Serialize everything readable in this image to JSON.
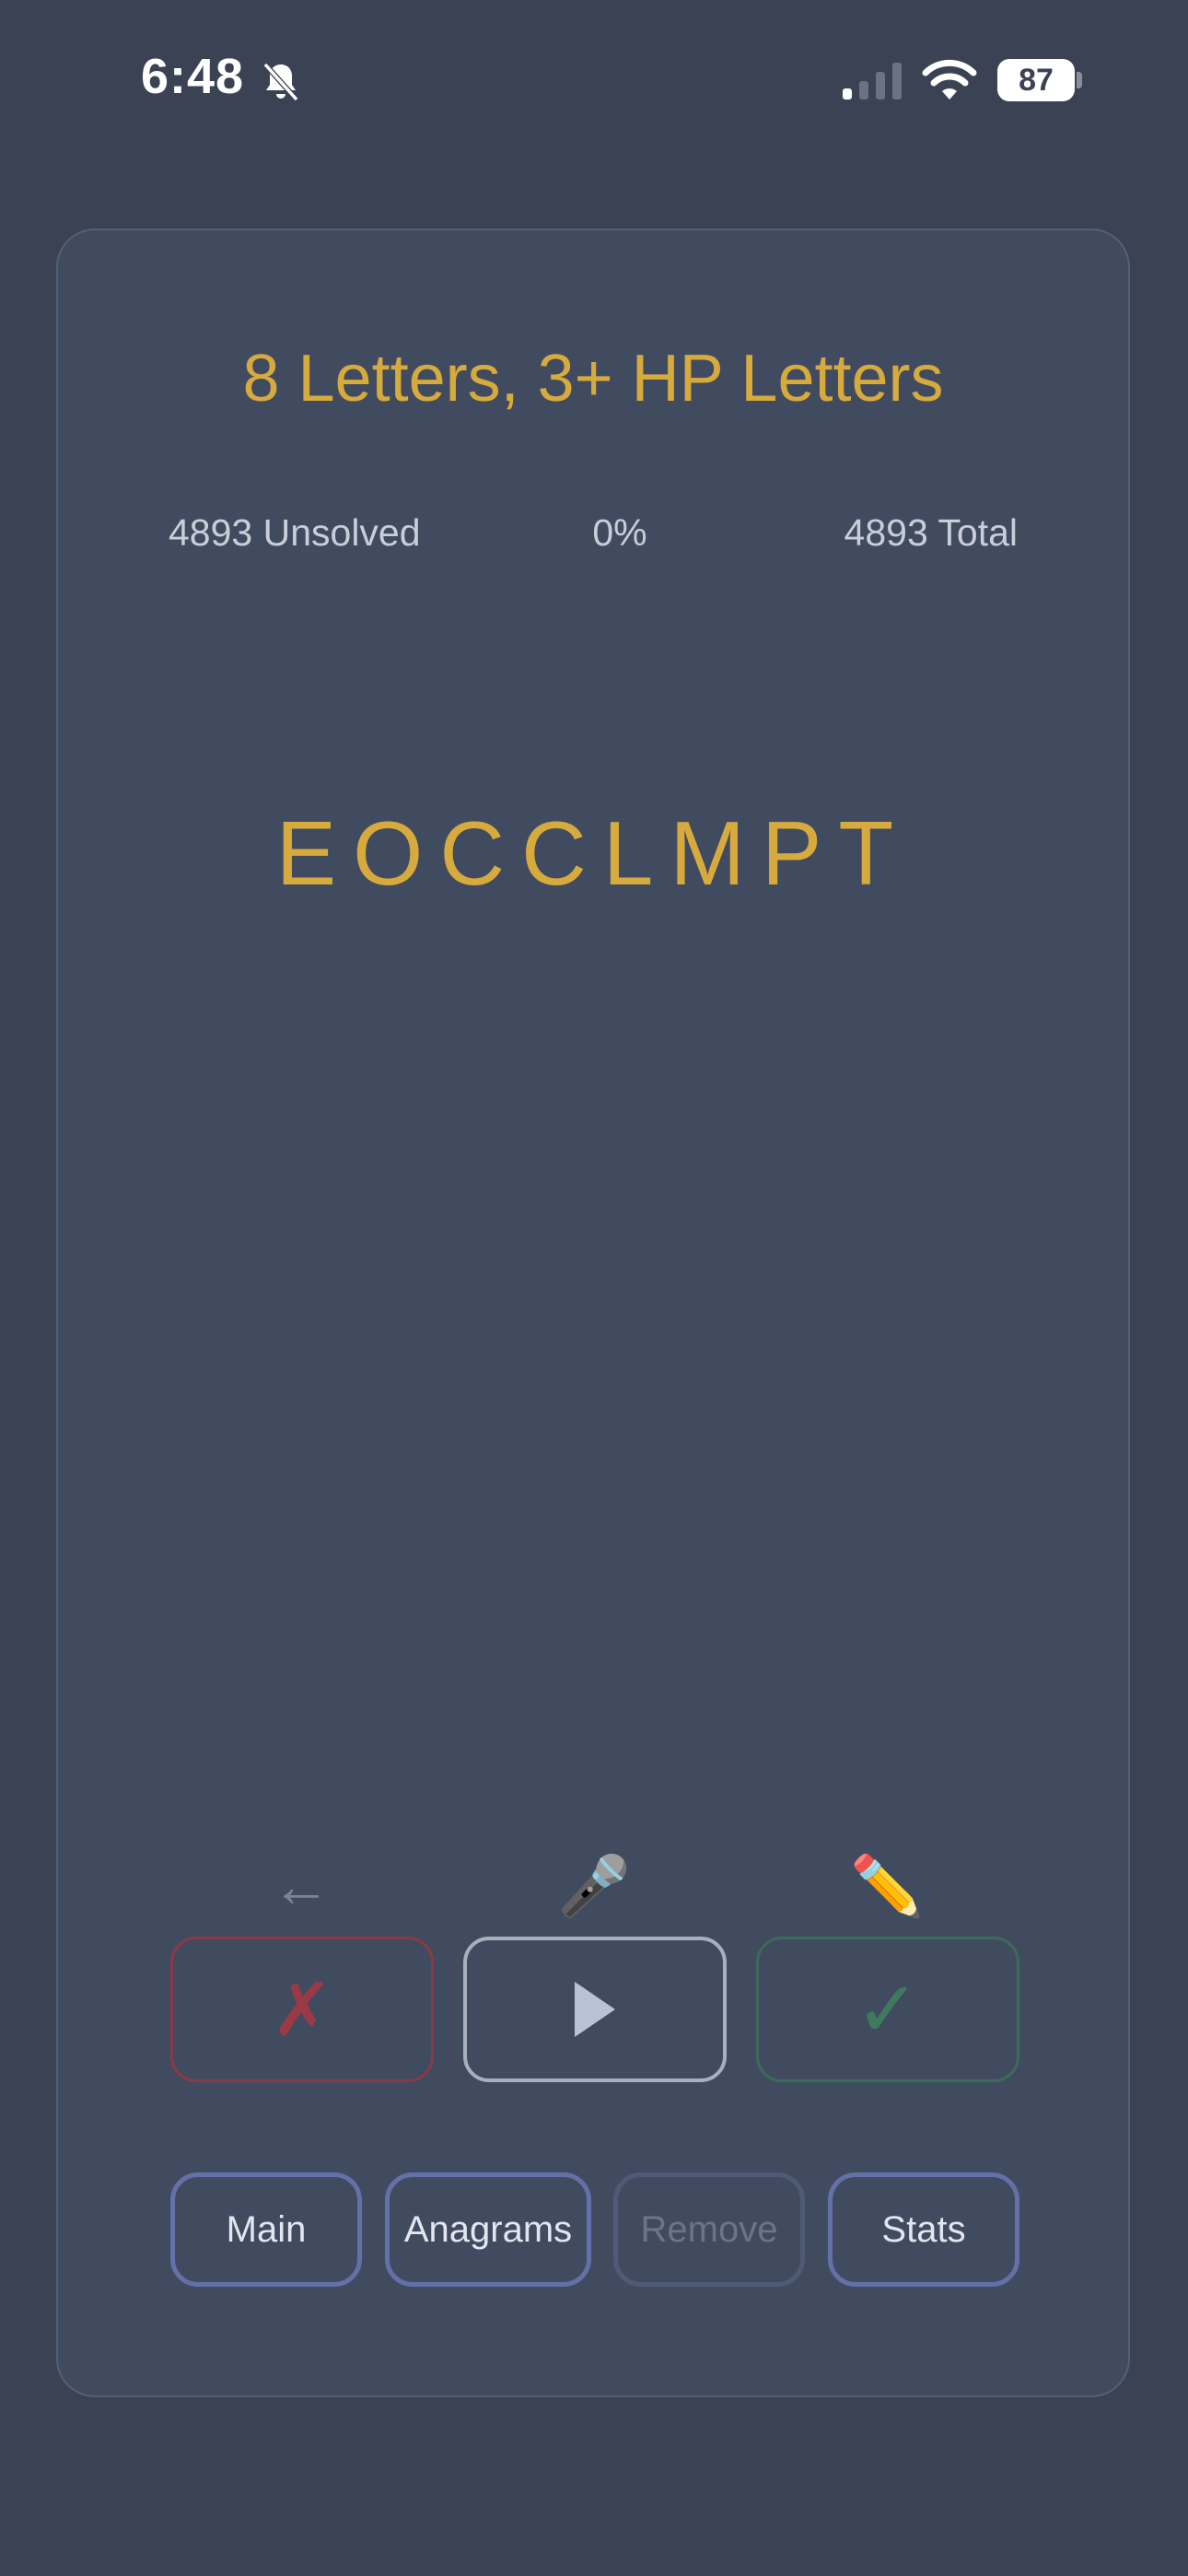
{
  "status_bar": {
    "time": "6:48",
    "battery": "87",
    "icons": [
      "bell-slash-icon",
      "cell-signal-icon",
      "wifi-icon",
      "battery-icon"
    ]
  },
  "game": {
    "title": "8 Letters, 3+ HP Letters",
    "unsolved": "4893 Unsolved",
    "percent": "0%",
    "total": "4893 Total",
    "letters": "EOCCLMPT"
  },
  "tools": {
    "back_icon": "←",
    "mic_icon": "🎤",
    "pencil_icon": "✏️"
  },
  "actions": {
    "wrong_label": "✗",
    "correct_label": "✓",
    "play_icon": "play-icon"
  },
  "nav": {
    "main": "Main",
    "anagrams": "Anagrams",
    "remove": "Remove",
    "stats": "Stats"
  },
  "colors": {
    "background": "#3a4254",
    "card": "#414b60",
    "accent_gold": "#d7aa3d",
    "wrong_red": "#8a3a44",
    "correct_green": "#3d6a5a",
    "nav_border": "#6470a8"
  }
}
